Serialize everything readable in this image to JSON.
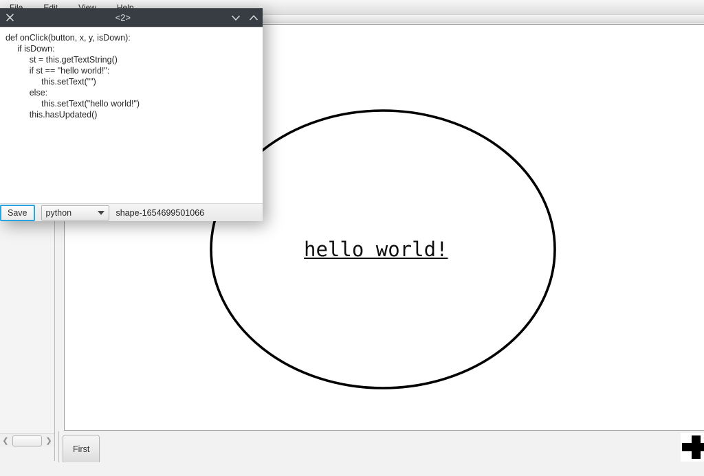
{
  "menubar": {
    "items": [
      {
        "label": "File"
      },
      {
        "label": "Edit"
      },
      {
        "label": "View"
      },
      {
        "label": "Help"
      }
    ]
  },
  "canvas": {
    "shape_text": "hello world!",
    "shape_type": "ellipse",
    "stroke_color": "#000000",
    "text_color": "#101010"
  },
  "tabbar": {
    "tabs": [
      {
        "label": "First"
      }
    ],
    "add_icon": "plus-icon"
  },
  "sidebar": {
    "scroll_left_icon": "chevron-left-icon",
    "scroll_right_icon": "chevron-right-icon"
  },
  "dialog": {
    "title": "<2>",
    "close_icon": "close-icon",
    "minimize_icon": "chevron-down-icon",
    "maximize_icon": "chevron-up-icon",
    "code_lines": [
      "def onClick(button, x, y, isDown):",
      "     if isDown:",
      "          st = this.getTextString()",
      "          if st == \"hello world!\":",
      "               this.setText(\"\")",
      "          else:",
      "               this.setText(\"hello world!\")",
      "          this.hasUpdated()"
    ],
    "save_label": "Save",
    "language_value": "python",
    "language_options": [
      "python"
    ],
    "shape_id": "shape-1654699501066",
    "focus_color": "#28a5e0",
    "titlebar_color": "#373d43"
  }
}
